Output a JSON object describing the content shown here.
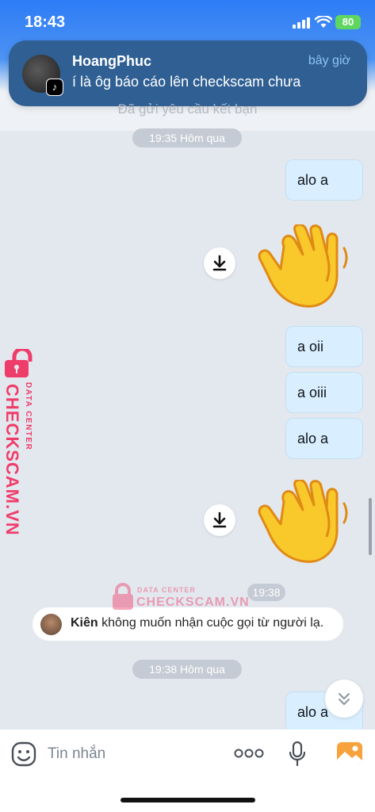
{
  "status_bar": {
    "time": "18:43",
    "battery": "80"
  },
  "notification": {
    "sender": "HoangPhuc",
    "time": "bây giờ",
    "message": "í là ôg báo cáo lên checkscam chưa",
    "app_icon": "tiktok-icon"
  },
  "chat": {
    "header_hint": "Đã gửi yêu cầu kết bạn",
    "time_separators": [
      "19:35 Hôm qua",
      "19:38 Hôm qua"
    ],
    "messages": [
      {
        "type": "text",
        "side": "right",
        "text": "alo a"
      },
      {
        "type": "sticker",
        "side": "right",
        "sticker": "waving-hand"
      },
      {
        "type": "text",
        "side": "right",
        "text": "a oii"
      },
      {
        "type": "text",
        "side": "right",
        "text": "a oiii"
      },
      {
        "type": "text",
        "side": "right",
        "text": "alo a"
      },
      {
        "type": "sticker",
        "side": "right",
        "sticker": "waving-hand"
      },
      {
        "type": "text",
        "side": "right",
        "text": "alo a"
      }
    ],
    "sticker_time_label": "19:38",
    "system_message": {
      "name": "Kiên",
      "text": " không muốn nhận cuộc gọi từ người lạ."
    }
  },
  "watermark": {
    "brand": "CHECKSCAM.VN",
    "sub": "DATA CENTER"
  },
  "input": {
    "placeholder": "Tin nhắn"
  },
  "colors": {
    "accent": "#2d7cf6",
    "bubble": "#d9efff",
    "watermark": "#ef3d6a",
    "battery": "#5fd65f"
  }
}
